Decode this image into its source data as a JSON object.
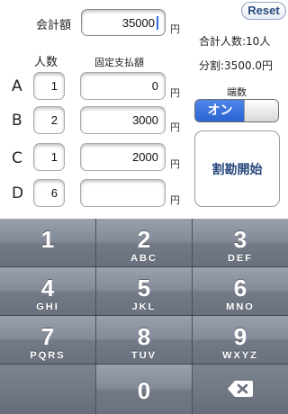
{
  "header": {
    "total_label": "会計額",
    "total_value": "35000",
    "currency": "円",
    "reset_label": "Reset",
    "people_summary": "合計人数:10人",
    "split_summary": "分割:3500.0円"
  },
  "columns": {
    "people_label": "人数",
    "fixed_label": "固定支払額"
  },
  "rows": [
    {
      "label": "A",
      "count": "1",
      "fixed": "0",
      "currency": "円"
    },
    {
      "label": "B",
      "count": "2",
      "fixed": "3000",
      "currency": "円"
    },
    {
      "label": "C",
      "count": "1",
      "fixed": "2000",
      "currency": "円"
    },
    {
      "label": "D",
      "count": "6",
      "fixed": "",
      "currency": "円"
    }
  ],
  "rounding": {
    "label": "端数",
    "state": "オン"
  },
  "start_button": "割勘開始",
  "keypad": {
    "keys": [
      {
        "num": "1",
        "letters": ""
      },
      {
        "num": "2",
        "letters": "ABC"
      },
      {
        "num": "3",
        "letters": "DEF"
      },
      {
        "num": "4",
        "letters": "GHI"
      },
      {
        "num": "5",
        "letters": "JKL"
      },
      {
        "num": "6",
        "letters": "MNO"
      },
      {
        "num": "7",
        "letters": "PQRS"
      },
      {
        "num": "8",
        "letters": "TUV"
      },
      {
        "num": "9",
        "letters": "WXYZ"
      },
      {
        "num": "0",
        "letters": ""
      }
    ]
  }
}
